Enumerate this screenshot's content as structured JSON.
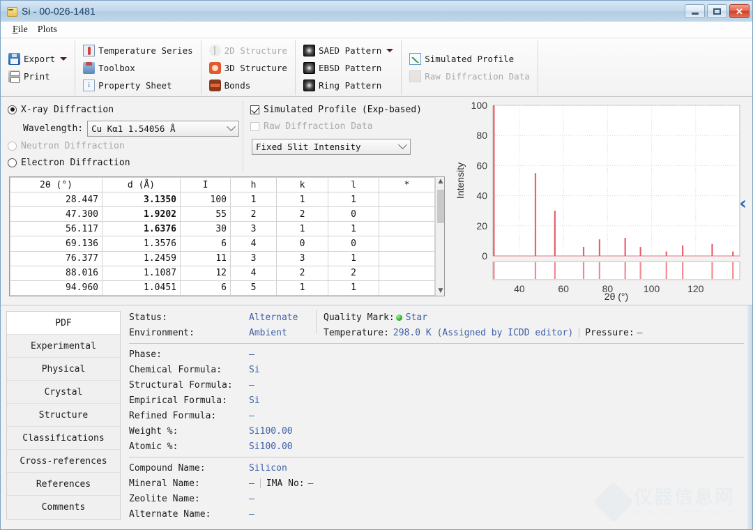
{
  "window": {
    "title": "Si - 00-026-1481",
    "icon": "card-icon",
    "buttons": {
      "minimize": "–",
      "maximize": "□",
      "close": "✕"
    }
  },
  "menubar": {
    "items": [
      "File",
      "Plots"
    ]
  },
  "toolbar": {
    "groups": [
      {
        "items": [
          {
            "label": "Export",
            "icon": "save-icon",
            "dropdown": true,
            "disabled": false
          },
          {
            "label": "Print",
            "icon": "printer-icon",
            "dropdown": false,
            "disabled": false
          }
        ]
      },
      {
        "items": [
          {
            "label": "Temperature Series",
            "icon": "thermometer-icon",
            "dropdown": false,
            "disabled": false
          },
          {
            "label": "Toolbox",
            "icon": "toolbox-icon",
            "dropdown": false,
            "disabled": false
          },
          {
            "label": "Property Sheet",
            "icon": "property-sheet-icon",
            "dropdown": false,
            "disabled": false
          }
        ]
      },
      {
        "items": [
          {
            "label": "2D Structure",
            "icon": "molecule-2d-icon",
            "dropdown": false,
            "disabled": true
          },
          {
            "label": "3D Structure",
            "icon": "molecule-3d-icon",
            "dropdown": false,
            "disabled": false
          },
          {
            "label": "Bonds",
            "icon": "bonds-icon",
            "dropdown": false,
            "disabled": false
          }
        ]
      },
      {
        "items": [
          {
            "label": "SAED Pattern",
            "icon": "saed-pattern-icon",
            "dropdown": true,
            "disabled": false
          },
          {
            "label": "EBSD Pattern",
            "icon": "ebsd-pattern-icon",
            "dropdown": false,
            "disabled": false
          },
          {
            "label": "Ring Pattern",
            "icon": "ring-pattern-icon",
            "dropdown": false,
            "disabled": false
          }
        ]
      },
      {
        "items": [
          {
            "label": "Simulated Profile",
            "icon": "simulated-profile-icon",
            "dropdown": false,
            "disabled": false
          },
          {
            "label": "Raw Diffraction Data",
            "icon": "raw-diffraction-icon",
            "dropdown": false,
            "disabled": true
          }
        ]
      }
    ]
  },
  "options": {
    "radiation": [
      {
        "label": "X-ray Diffraction",
        "checked": true,
        "disabled": false
      },
      {
        "label": "Neutron Diffraction",
        "checked": false,
        "disabled": true
      },
      {
        "label": "Electron Diffraction",
        "checked": false,
        "disabled": false
      }
    ],
    "wavelength_label": "Wavelength:",
    "wavelength_value": "Cu Kα1 1.54056 Å",
    "checkboxes": [
      {
        "label": "Simulated Profile (Exp-based)",
        "checked": true,
        "disabled": false
      },
      {
        "label": "Raw Diffraction Data",
        "checked": false,
        "disabled": true
      }
    ],
    "slit_value": "Fixed Slit Intensity"
  },
  "table": {
    "headers": [
      "2θ (°)",
      "d (Å)",
      "I",
      "h",
      "k",
      "l",
      "*"
    ],
    "rows": [
      {
        "two_theta": "28.447",
        "d": "3.1350",
        "I": "100",
        "h": "1",
        "k": "1",
        "l": "1",
        "star": "",
        "d_bold": true
      },
      {
        "two_theta": "47.300",
        "d": "1.9202",
        "I": "55",
        "h": "2",
        "k": "2",
        "l": "0",
        "star": "",
        "d_bold": true
      },
      {
        "two_theta": "56.117",
        "d": "1.6376",
        "I": "30",
        "h": "3",
        "k": "1",
        "l": "1",
        "star": "",
        "d_bold": true
      },
      {
        "two_theta": "69.136",
        "d": "1.3576",
        "I": "6",
        "h": "4",
        "k": "0",
        "l": "0",
        "star": "",
        "d_bold": false
      },
      {
        "two_theta": "76.377",
        "d": "1.2459",
        "I": "11",
        "h": "3",
        "k": "3",
        "l": "1",
        "star": "",
        "d_bold": false
      },
      {
        "two_theta": "88.016",
        "d": "1.1087",
        "I": "12",
        "h": "4",
        "k": "2",
        "l": "2",
        "star": "",
        "d_bold": false
      },
      {
        "two_theta": "94.960",
        "d": "1.0451",
        "I": "6",
        "h": "5",
        "k": "1",
        "l": "1",
        "star": "",
        "d_bold": false
      }
    ]
  },
  "chart_data": {
    "type": "bar",
    "title": "",
    "xlabel": "2θ (°)",
    "ylabel": "Intensity",
    "xlim": [
      28,
      140
    ],
    "ylim": [
      0,
      100
    ],
    "xticks": [
      40,
      60,
      80,
      100,
      120
    ],
    "yticks": [
      0,
      20,
      40,
      60,
      80,
      100
    ],
    "grid": true,
    "legend": null,
    "series_color": "#e8606b",
    "x": [
      28.447,
      47.3,
      56.117,
      69.136,
      76.377,
      88.016,
      94.96,
      106.7,
      114.1,
      127.5,
      136.9
    ],
    "values": [
      100,
      55,
      30,
      6,
      11,
      12,
      6,
      3,
      7,
      8,
      3
    ],
    "tick_marks_row": [
      28.447,
      47.3,
      56.117,
      69.136,
      76.377,
      88.016,
      94.96,
      106.7,
      114.1,
      127.5,
      136.9
    ]
  },
  "collapse_arrow": "‹",
  "tabs": {
    "active": "PDF",
    "items": [
      "PDF",
      "Experimental",
      "Physical",
      "Crystal",
      "Structure",
      "Classifications",
      "Cross-references",
      "References",
      "Comments"
    ]
  },
  "details": {
    "status_label": "Status:",
    "status_value": "Alternate",
    "environment_label": "Environment:",
    "environment_value": "Ambient",
    "quality_mark_label": "Quality Mark:",
    "quality_mark_value": "Star",
    "quality_mark_color": "#29a829",
    "temperature_label": "Temperature:",
    "temperature_value": "298.0 K (Assigned by ICDD editor)",
    "pressure_label": "Pressure:",
    "pressure_value": "–",
    "fields": [
      {
        "label": "Phase:",
        "value": "–"
      },
      {
        "label": "Chemical Formula:",
        "value": "Si"
      },
      {
        "label": "Structural Formula:",
        "value": "–"
      },
      {
        "label": "Empirical Formula:",
        "value": "Si"
      },
      {
        "label": "Refined Formula:",
        "value": "–"
      }
    ],
    "percents": [
      {
        "label": "Weight %:",
        "value": "Si100.00"
      },
      {
        "label": "Atomic %:",
        "value": "Si100.00"
      }
    ],
    "names": [
      {
        "label": "Compound Name:",
        "value": "Silicon"
      },
      {
        "label": "Mineral Name:",
        "value": "–",
        "extra_label": "IMA No:",
        "extra_value": "–"
      },
      {
        "label": "Zeolite Name:",
        "value": "–"
      },
      {
        "label": "Alternate Name:",
        "value": "–"
      }
    ]
  },
  "watermark": {
    "cn": "仪器信息网",
    "en": "www.instrument.com.cn"
  }
}
